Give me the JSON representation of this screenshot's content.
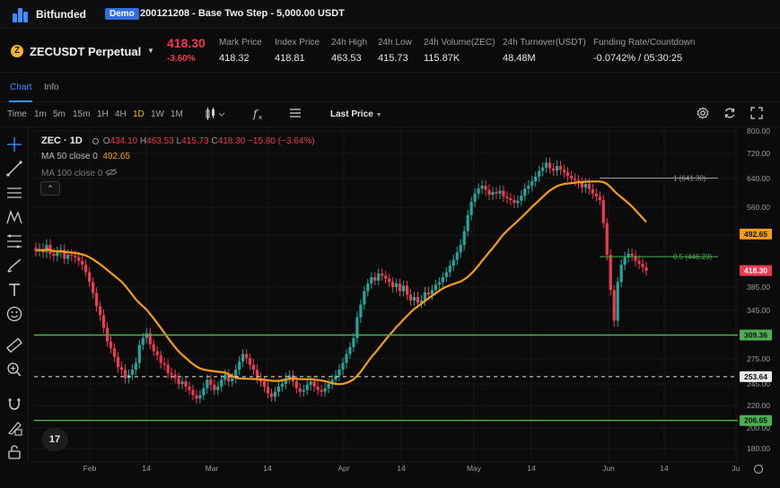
{
  "app": {
    "brand": "Bitfunded",
    "demo_badge": "Demo",
    "account": "200121208 - Base Two Step - 5,000.00 USDT"
  },
  "ticker": {
    "coin_glyph": "Z",
    "symbol": "ZECUSDT Perpetual",
    "last_price": "418.30",
    "change_pct": "-3.60%",
    "stats": [
      {
        "label": "Mark Price",
        "value": "418.32"
      },
      {
        "label": "Index Price",
        "value": "418.81"
      },
      {
        "label": "24h High",
        "value": "463.53"
      },
      {
        "label": "24h Low",
        "value": "415.73"
      },
      {
        "label": "24h Volume(ZEC)",
        "value": "115.87K"
      },
      {
        "label": "24h Turnover(USDT)",
        "value": "48.48M"
      },
      {
        "label": "Funding Rate/Countdown",
        "value": "-0.0742% / 05:30:25"
      }
    ]
  },
  "tabs": [
    "Chart",
    "Info"
  ],
  "toolbar": {
    "timeframes": [
      "Time",
      "1m",
      "5m",
      "15m",
      "1H",
      "4H",
      "1D",
      "1W",
      "1M"
    ],
    "active_timeframe": "1D",
    "price_type": "Last Price"
  },
  "legend": {
    "title": "ZEC · 1D",
    "ohlc": {
      "o_label": "O",
      "o": "434.10",
      "h_label": "H",
      "h": "463.53",
      "l_label": "L",
      "l": "415.73",
      "c_label": "C",
      "c": "418.30",
      "change": "−15.80 (−3.64%)"
    },
    "ma50_label": "MA 50 close 0",
    "ma50_value": "492.65",
    "ma100_label": "MA 100 close 0"
  },
  "watermark": "17",
  "colors": {
    "up": "#26a69a",
    "down": "#ef3b4f",
    "ma50": "#f59c1a",
    "level": "#4caf50",
    "fib": "#9e9e9e",
    "accent": "#3f8cff"
  },
  "chart_data": {
    "type": "candlestick",
    "y_ticks": [
      800,
      720,
      640,
      560,
      490,
      385,
      345,
      310,
      275,
      245,
      220,
      200,
      180
    ],
    "x_ticks": [
      "Feb",
      "14",
      "Mar",
      "14",
      "Apr",
      "14",
      "May",
      "14",
      "Jun",
      "14",
      "Ju"
    ],
    "ylim": [
      180,
      800
    ],
    "grid": true,
    "horizontal_levels": [
      {
        "label": "309.36",
        "price": 309.36,
        "style": "solid"
      },
      {
        "label": "206.65",
        "price": 206.65,
        "style": "solid"
      },
      {
        "label": "253.64",
        "price": 253.64,
        "style": "dashed"
      }
    ],
    "price_labels": [
      {
        "label": "492.65",
        "price": 492.65
      },
      {
        "label": "418.30",
        "price": 418.3
      }
    ],
    "fibonacci": [
      {
        "label": "1 (641.30)",
        "price": 641.3
      },
      {
        "label": "0.5 (446.23)",
        "price": 446.23
      }
    ]
  }
}
